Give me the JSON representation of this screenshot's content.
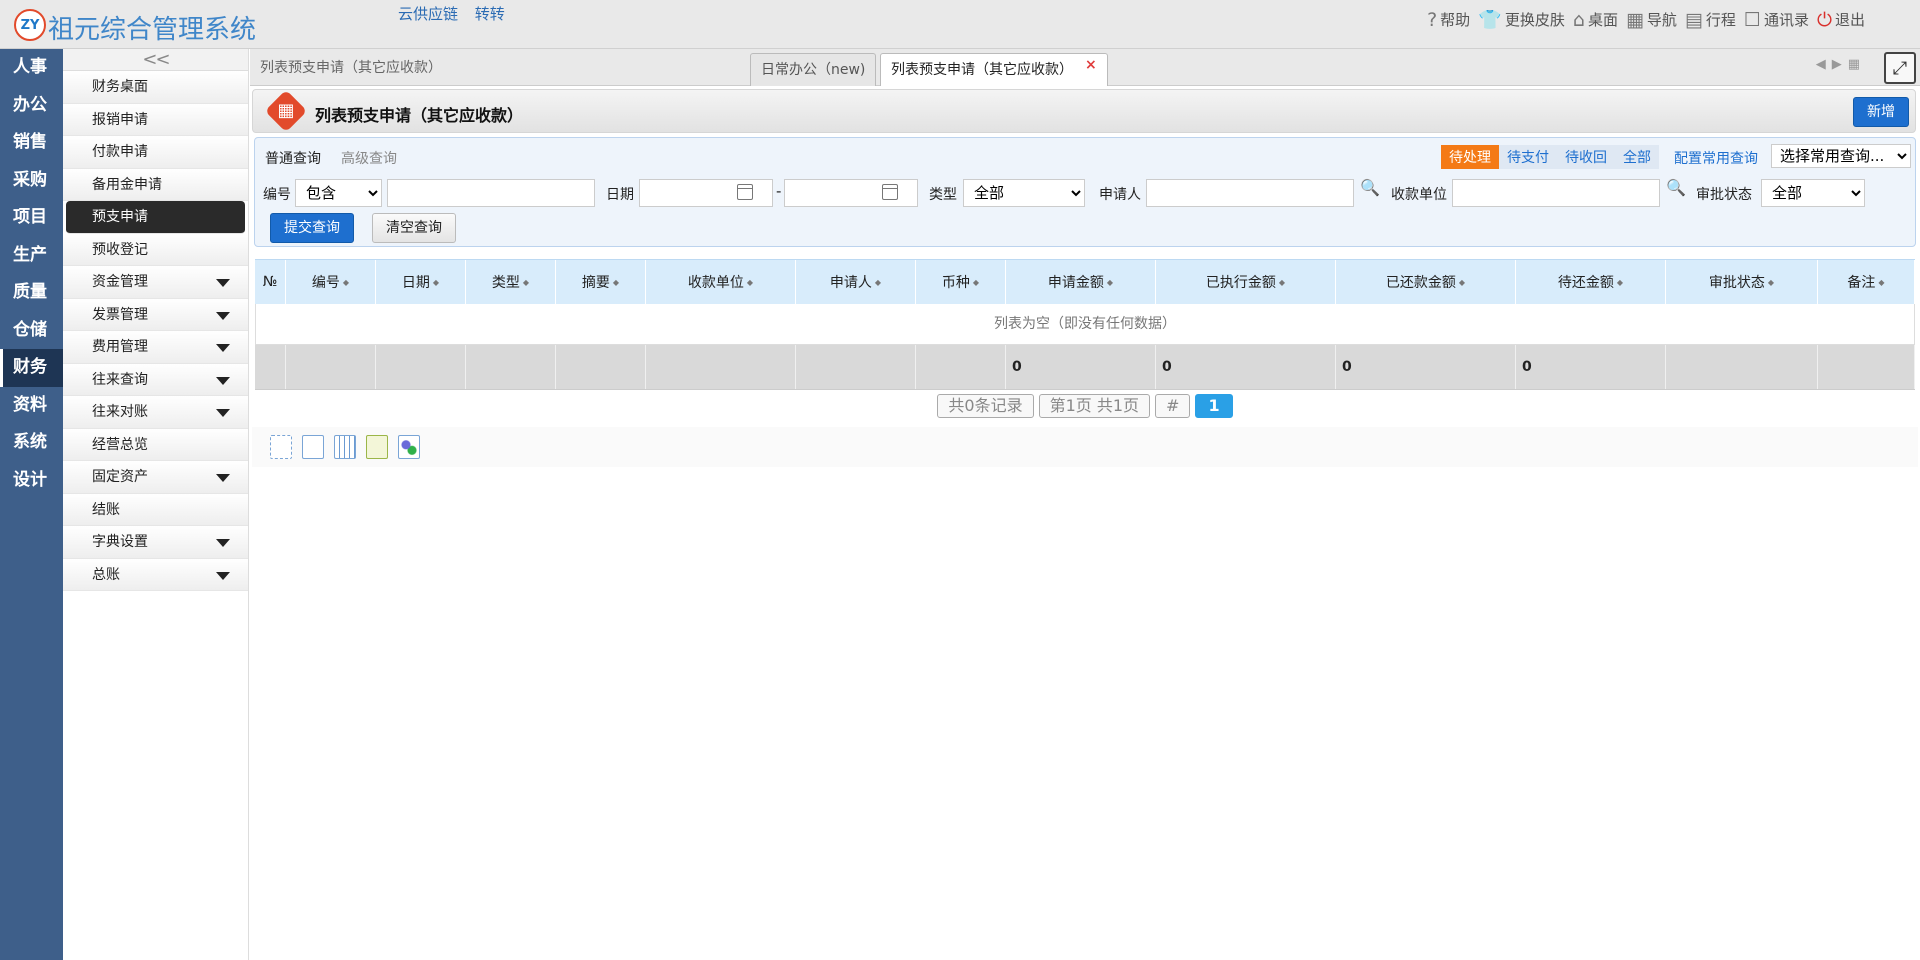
{
  "app": {
    "logo_text": "ZY",
    "title": "祖元综合管理系统"
  },
  "top_links": [
    "云供应链",
    "转转"
  ],
  "top_icons": [
    {
      "icon": "help-icon",
      "glyph": "?",
      "label": "帮助"
    },
    {
      "icon": "shirt-icon",
      "glyph": "👕",
      "label": "更换皮肤"
    },
    {
      "icon": "home-icon",
      "glyph": "⌂",
      "label": "桌面"
    },
    {
      "icon": "grid-icon",
      "glyph": "▦",
      "label": "导航"
    },
    {
      "icon": "calendar-icon",
      "glyph": "▤",
      "label": "行程"
    },
    {
      "icon": "contacts-icon",
      "glyph": "☐",
      "label": "通讯录"
    },
    {
      "icon": "power-icon",
      "glyph": "⏻",
      "label": "退出"
    }
  ],
  "left_nav": [
    "人事",
    "办公",
    "销售",
    "采购",
    "项目",
    "生产",
    "质量",
    "仓储",
    "财务",
    "资料",
    "系统",
    "设计"
  ],
  "left_nav_active": "财务",
  "submenu": {
    "collapse": "<<",
    "items": [
      {
        "label": "财务桌面",
        "expand": false
      },
      {
        "label": "报销申请",
        "expand": false
      },
      {
        "label": "付款申请",
        "expand": false
      },
      {
        "label": "备用金申请",
        "expand": false
      },
      {
        "label": "预支申请",
        "expand": false,
        "active": true
      },
      {
        "label": "预收登记",
        "expand": false
      },
      {
        "label": "资金管理",
        "expand": true
      },
      {
        "label": "发票管理",
        "expand": true
      },
      {
        "label": "费用管理",
        "expand": true
      },
      {
        "label": "往来查询",
        "expand": true
      },
      {
        "label": "往来对账",
        "expand": true
      },
      {
        "label": "经营总览",
        "expand": false
      },
      {
        "label": "固定资产",
        "expand": true
      },
      {
        "label": "结账",
        "expand": false
      },
      {
        "label": "字典设置",
        "expand": true
      },
      {
        "label": "总账",
        "expand": true
      }
    ]
  },
  "tabs": {
    "page_label": "列表预支申请（其它应收款）",
    "items": [
      {
        "label": "日常办公（new)",
        "active": false
      },
      {
        "label": "列表预支申请（其它应收款）",
        "active": true,
        "close": "×"
      }
    ]
  },
  "header": {
    "title": "列表预支申请（其它应收款）",
    "new_button": "新增"
  },
  "query": {
    "tab_normal": "普通查询",
    "tab_advanced": "高级查询",
    "status_filters": [
      "待处理",
      "待支付",
      "待收回",
      "全部"
    ],
    "status_active": "待处理",
    "config_link": "配置常用查询",
    "common_query": "选择常用查询...",
    "code_label": "编号",
    "code_op": "包含",
    "date_label": "日期",
    "date_sep": "-",
    "type_label": "类型",
    "type_value": "全部",
    "applicant_label": "申请人",
    "payee_label": "收款单位",
    "approval_label": "审批状态",
    "approval_value": "全部",
    "submit": "提交查询",
    "clear": "清空查询"
  },
  "grid": {
    "columns": [
      "№",
      "编号",
      "日期",
      "类型",
      "摘要",
      "收款单位",
      "申请人",
      "币种",
      "申请金额",
      "已执行金额",
      "已还款金额",
      "待还金额",
      "审批状态",
      "备注"
    ],
    "empty_text": "列表为空（即没有任何数据）",
    "totals": [
      "",
      "",
      "",
      "",
      "",
      "",
      "",
      "",
      "0",
      "0",
      "0",
      "0",
      "",
      ""
    ]
  },
  "pager": {
    "records": "共0条记录",
    "pages": "第1页 共1页",
    "hash": "#",
    "current": "1"
  }
}
